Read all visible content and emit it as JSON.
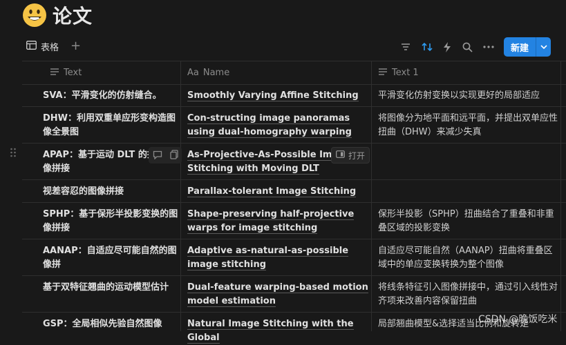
{
  "page": {
    "title": "论文",
    "emoji": "smiling-face-emoji"
  },
  "toolbar": {
    "view_tab_label": "表格",
    "new_button_label": "新建",
    "icons": [
      "filter-icon",
      "sort-icon",
      "lightning-icon",
      "search-icon",
      "more-icon"
    ]
  },
  "columns": [
    {
      "type_icon": "text-lines-icon",
      "label": "Text"
    },
    {
      "type_icon": "Aa",
      "label": "Name"
    },
    {
      "type_icon": "text-lines-icon",
      "label": "Text 1"
    }
  ],
  "rows": [
    {
      "text": "SVA：平滑变化的仿射缝合。",
      "name": "Smoothly Varying Affine Stitching",
      "text1": "平滑变化仿射变换以实现更好的局部适应"
    },
    {
      "text": "DHW：利用双重单应形变构造图像全景图",
      "name": "Con-structing image panoramas using dual-homography warping",
      "text1": "将图像分为地平面和远平面，并提出双单应性扭曲（DHW）来减少失真"
    },
    {
      "text": "APAP：基于运动 DLT 的投影图像拼接",
      "name": "As-Projective-As-Possible Image Stitching with Moving DLT",
      "text1": ""
    },
    {
      "text": "视差容忍的图像拼接",
      "name": "Parallax-tolerant Image Stitching",
      "text1": ""
    },
    {
      "text": "SPHP：基于保形半投影变换的图像拼接",
      "name": "Shape-preserving half-projective warps for image stitching",
      "text1": "保形半投影（SPHP）扭曲结合了重叠和非重叠区域的投影变换"
    },
    {
      "text": "AANAP：自适应尽可能自然的图像拼",
      "name": "Adaptive as-natural-as-possible image stitching",
      "text1": "自适应尽可能自然（AANAP）扭曲将重叠区域中的单应变换转换为整个图像"
    },
    {
      "text": "基于双特征翘曲的运动模型估计",
      "name": "Dual-feature warping-based motion model estimation",
      "text1": "将线条特征引入图像拼接中，通过引入线性对齐项来改善内容保留扭曲"
    },
    {
      "text": "GSP：全局相似先验自然图像",
      "name": "Natural Image Stitching with the Global",
      "text1": "局部翘曲模型&选择适当比例和旋转是"
    }
  ],
  "row_hover": {
    "open_label": "打开"
  },
  "watermark": "CSDN @晚饭吃米"
}
